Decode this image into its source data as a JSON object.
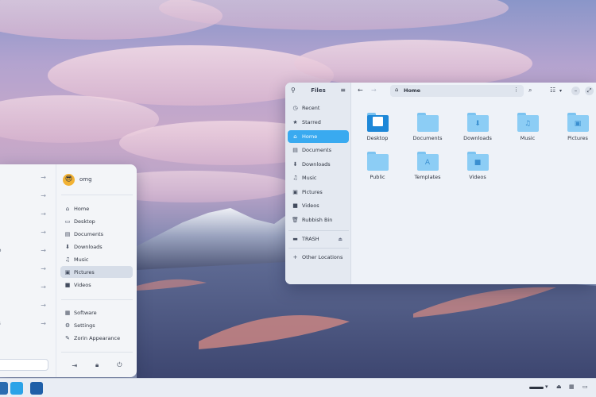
{
  "start_menu": {
    "user": {
      "name": "omg"
    },
    "categories": [
      "",
      "",
      "",
      "",
      "eo",
      "o",
      "",
      "",
      "os"
    ],
    "places": [
      {
        "label": "Home",
        "icon": "home-icon"
      },
      {
        "label": "Desktop",
        "icon": "desktop-icon"
      },
      {
        "label": "Documents",
        "icon": "document-icon"
      },
      {
        "label": "Downloads",
        "icon": "download-icon"
      },
      {
        "label": "Music",
        "icon": "music-icon"
      },
      {
        "label": "Pictures",
        "icon": "picture-icon",
        "active": true
      },
      {
        "label": "Videos",
        "icon": "video-icon"
      }
    ],
    "system": [
      {
        "label": "Software",
        "icon": "software-icon"
      },
      {
        "label": "Settings",
        "icon": "gear-icon"
      },
      {
        "label": "Zorin Appearance",
        "icon": "appearance-icon"
      }
    ]
  },
  "files": {
    "title": "Files",
    "path": "Home",
    "sidebar": [
      {
        "label": "Recent",
        "icon": "clock-icon"
      },
      {
        "label": "Starred",
        "icon": "star-icon"
      },
      {
        "label": "Home",
        "icon": "home-icon",
        "active": true
      },
      {
        "label": "Documents",
        "icon": "document-icon"
      },
      {
        "label": "Downloads",
        "icon": "download-icon"
      },
      {
        "label": "Music",
        "icon": "music-icon"
      },
      {
        "label": "Pictures",
        "icon": "picture-icon"
      },
      {
        "label": "Videos",
        "icon": "video-icon"
      },
      {
        "label": "Rubbish Bin",
        "icon": "trash-icon"
      }
    ],
    "devices": [
      {
        "label": "TRASH",
        "icon": "drive-icon"
      }
    ],
    "other": [
      {
        "label": "Other Locations",
        "icon": "plus-icon"
      }
    ],
    "items": [
      {
        "name": "Desktop",
        "emblem": ""
      },
      {
        "name": "Documents",
        "emblem": ""
      },
      {
        "name": "Downloads",
        "emblem": "⬇"
      },
      {
        "name": "Music",
        "emblem": "♫"
      },
      {
        "name": "Pictures",
        "emblem": "▣"
      },
      {
        "name": "Public",
        "emblem": ""
      },
      {
        "name": "Templates",
        "emblem": "A"
      },
      {
        "name": "Videos",
        "emblem": "■"
      }
    ]
  }
}
